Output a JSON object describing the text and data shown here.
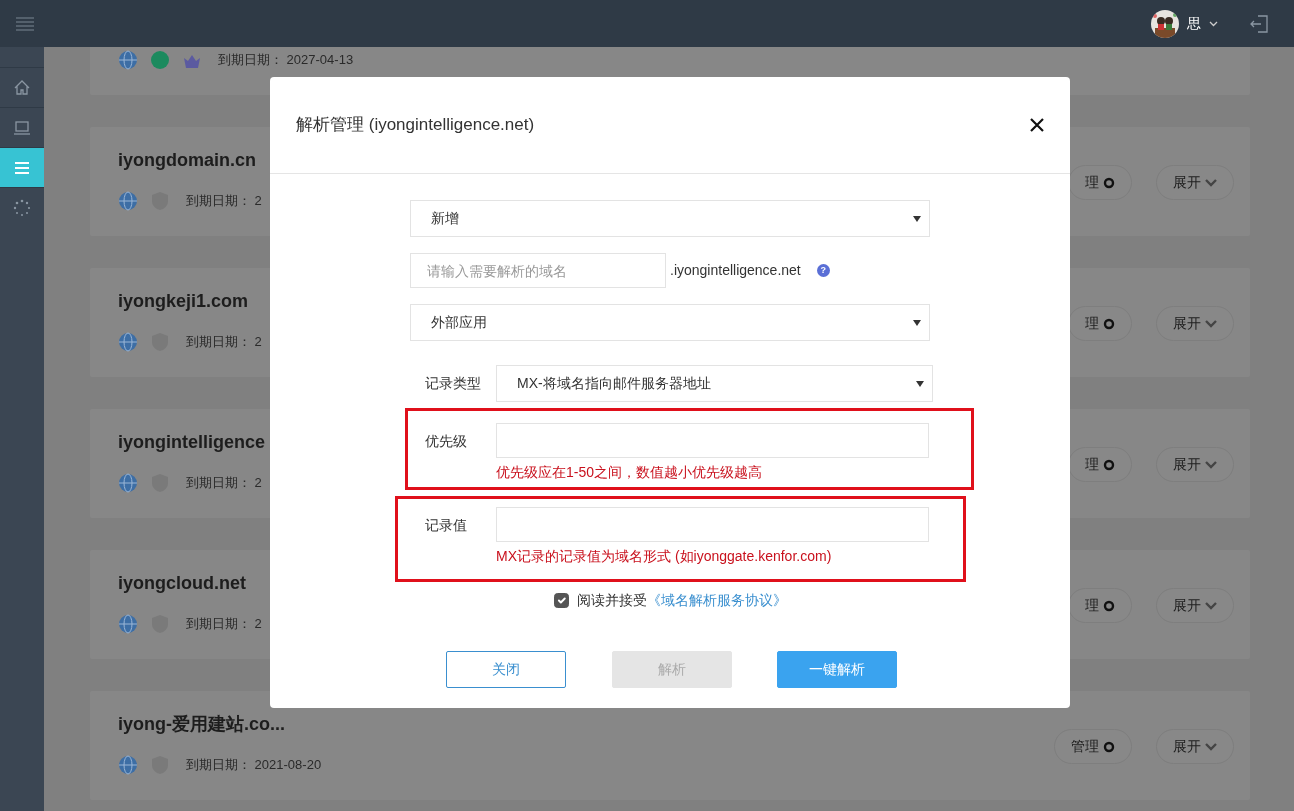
{
  "header": {
    "user_name": "思"
  },
  "sidebar": {
    "items": [
      {
        "kind": "home",
        "selected": false
      },
      {
        "kind": "laptop",
        "selected": false
      },
      {
        "kind": "menu",
        "selected": true
      },
      {
        "kind": "loader",
        "selected": false
      }
    ]
  },
  "domains": [
    {
      "badges": [
        {
          "kind": "globe"
        },
        {
          "kind": "dot"
        },
        {
          "kind": "crown"
        }
      ],
      "expiry_label": "到期日期：",
      "expiry": "2027-04-13"
    },
    {
      "name": "iyongdomain.cn",
      "badges": [
        {
          "kind": "globe"
        },
        {
          "kind": "icp"
        }
      ],
      "expiry_label": "到期日期：",
      "expiry": "2",
      "manage_label": "理",
      "expand_label": "展开"
    },
    {
      "name": "iyongkeji1.com",
      "badges": [
        {
          "kind": "globe"
        },
        {
          "kind": "icp"
        }
      ],
      "expiry_label": "到期日期：",
      "expiry": "2",
      "manage_label": "理",
      "expand_label": "展开"
    },
    {
      "name": "iyongintelligence",
      "badges": [
        {
          "kind": "globe"
        },
        {
          "kind": "icp"
        }
      ],
      "expiry_label": "到期日期：",
      "expiry": "2",
      "manage_label": "理",
      "expand_label": "展开"
    },
    {
      "name": "iyongcloud.net",
      "badges": [
        {
          "kind": "globe"
        },
        {
          "kind": "icp"
        }
      ],
      "expiry_label": "到期日期：",
      "expiry": "2",
      "manage_label": "理",
      "expand_label": "展开"
    },
    {
      "name": "iyong-爱用建站.co...",
      "badges": [
        {
          "kind": "globe"
        },
        {
          "kind": "icp"
        }
      ],
      "expiry_label": "到期日期：",
      "expiry": "2021-08-20",
      "manage_label": "管理",
      "expand_label": "展开"
    }
  ],
  "modal": {
    "title": "解析管理 (iyongintelligence.net)",
    "action_select": {
      "value": "新增"
    },
    "subdomain": {
      "placeholder": "请输入需要解析的域名",
      "suffix": ".iyongintelligence.net",
      "help": "?"
    },
    "app_select": {
      "value": "外部应用"
    },
    "record_type": {
      "label": "记录类型",
      "value": "MX-将域名指向邮件服务器地址"
    },
    "fields": [
      {
        "label": "优先级",
        "hint": "优先级应在1-50之间，数值越小优先级越高",
        "highlighted": true
      },
      {
        "label": "记录值",
        "hint": "MX记录的记录值为域名形式 (如iyonggate.kenfor.com)",
        "highlighted": true
      }
    ],
    "agreement": {
      "checked": true,
      "text": "阅读并接受",
      "link": "《域名解析服务协议》"
    },
    "buttons": [
      {
        "label": "关闭",
        "kind": "outline",
        "disabled": false
      },
      {
        "label": "解析",
        "kind": "plain",
        "disabled": true
      },
      {
        "label": "一键解析",
        "kind": "primary",
        "disabled": false
      }
    ]
  }
}
